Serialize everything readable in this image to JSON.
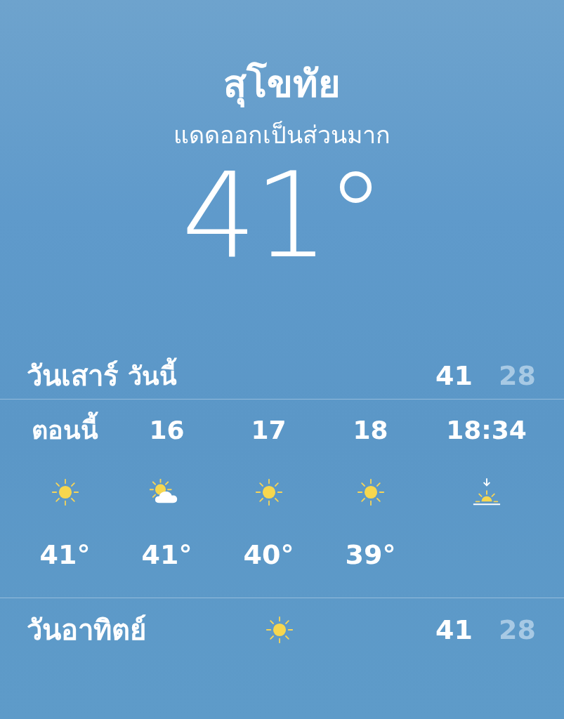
{
  "location": {
    "city": "สุโขทัย",
    "condition": "แดดออกเป็นส่วนมาก",
    "temperature": "41°"
  },
  "today": {
    "day": "วันเสาร์",
    "label": "วันนี้",
    "high": "41",
    "low": "28"
  },
  "hourly": [
    {
      "time": "ตอนนี้",
      "kind": "sun",
      "temp": "41°"
    },
    {
      "time": "16",
      "kind": "partly-cloudy",
      "temp": "41°"
    },
    {
      "time": "17",
      "kind": "sun",
      "temp": "40°"
    },
    {
      "time": "18",
      "kind": "sun",
      "temp": "39°"
    },
    {
      "time": "18:34",
      "kind": "sunset"
    }
  ],
  "daily": [
    {
      "day": "วันอาทิตย์",
      "kind": "sun",
      "high": "41",
      "low": "28"
    }
  ]
}
